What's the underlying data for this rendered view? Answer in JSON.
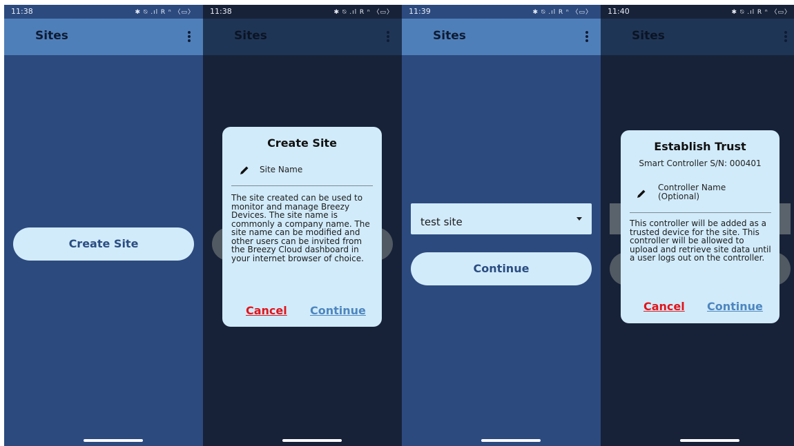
{
  "status_bar": {
    "times": [
      "11:38",
      "11:38",
      "11:39",
      "11:40"
    ],
    "icons_text": "✱ ⍉ .ıl R ⁿ 〈▭〉"
  },
  "app": {
    "title": "Sites"
  },
  "screen1": {
    "create_button_label": "Create Site"
  },
  "create_site_dialog": {
    "title": "Create Site",
    "field_label": "Site Name",
    "body": "The site created can be used to monitor and manage Breezy Devices. The site name is commonly a company name. The site name can be modified and other users can be invited from the Breezy Cloud dashboard in your internet browser of choice.",
    "cancel_label": "Cancel",
    "continue_label": "Continue"
  },
  "screen3": {
    "dropdown_value": "test site",
    "continue_label": "Continue"
  },
  "establish_trust_dialog": {
    "title": "Establish Trust",
    "subtitle": "Smart Controller S/N: 000401",
    "field_label": "Controller Name (Optional)",
    "body": "This controller will be added as a trusted device for the site. This controller will be allowed to upload and retrieve site data until a user logs out on the controller.",
    "cancel_label": "Cancel",
    "continue_label": "Continue"
  },
  "colors": {
    "appbar": "#4f7fb9",
    "background": "#2c4a7e",
    "dialog": "#d1ebfa",
    "cancel": "#e0151b",
    "continue": "#4d86bf"
  }
}
